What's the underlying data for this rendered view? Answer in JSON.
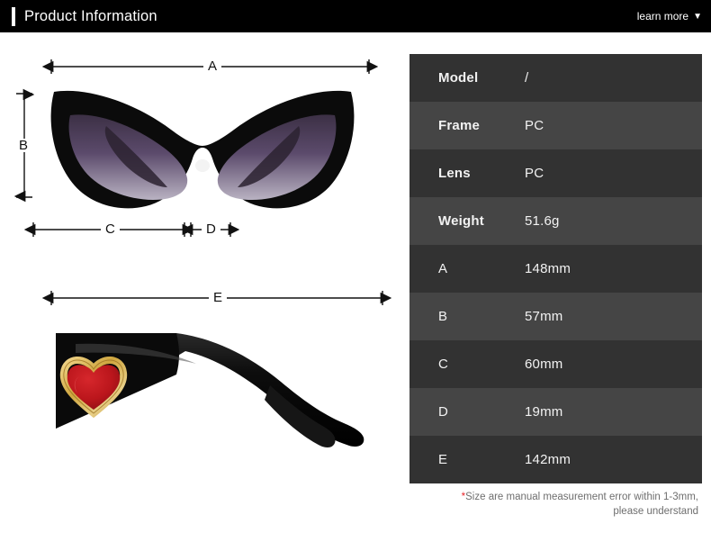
{
  "header": {
    "title": "Product Information",
    "learn_more_label": "learn more",
    "caret_icon": "chevron-down-icon",
    "background_color": "#000000",
    "accent_color": "#ffffff"
  },
  "diagram": {
    "front_view_alt": "cat-eye sunglasses front view, black frame with purple gradient lenses",
    "side_view_alt": "sunglasses side view, black temple arm with red heart gold-beaded emblem",
    "frame_color": "#111111",
    "lens_color": "#4a3a58",
    "heart_color": "#c0171d",
    "heart_border_color": "#d6ac4a",
    "dimension_labels": [
      {
        "id": "A",
        "label": "A",
        "orientation": "horizontal"
      },
      {
        "id": "B",
        "label": "B",
        "orientation": "vertical"
      },
      {
        "id": "C",
        "label": "C",
        "orientation": "horizontal"
      },
      {
        "id": "D",
        "label": "D",
        "orientation": "horizontal"
      },
      {
        "id": "E",
        "label": "E",
        "orientation": "horizontal"
      }
    ]
  },
  "spec_table": {
    "row_color_odd": "#323232",
    "row_color_even": "#454545",
    "text_color": "#f2f2f2",
    "rows": [
      {
        "key": "Model",
        "value": "/",
        "kind": "attr"
      },
      {
        "key": "Frame",
        "value": "PC",
        "kind": "attr"
      },
      {
        "key": "Lens",
        "value": "PC",
        "kind": "attr"
      },
      {
        "key": "Weight",
        "value": "51.6g",
        "kind": "attr"
      },
      {
        "key": "A",
        "value": "148mm",
        "kind": "dim"
      },
      {
        "key": "B",
        "value": "57mm",
        "kind": "dim"
      },
      {
        "key": "C",
        "value": "60mm",
        "kind": "dim"
      },
      {
        "key": "D",
        "value": "19mm",
        "kind": "dim"
      },
      {
        "key": "E",
        "value": "142mm",
        "kind": "dim"
      }
    ],
    "note_star": "*",
    "note_line1": "Size are manual measurement error within 1-3mm,",
    "note_line2": "please understand",
    "note_color": "#6e6e6e",
    "note_star_color": "#e8252a"
  }
}
